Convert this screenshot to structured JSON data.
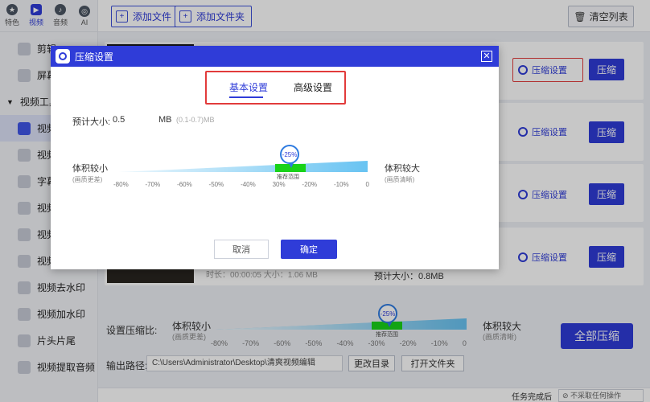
{
  "sidebar": {
    "topnav": [
      {
        "label": "特色",
        "icon": "star-icon"
      },
      {
        "label": "视频",
        "icon": "video-icon",
        "active": true
      },
      {
        "label": "音频",
        "icon": "music-icon"
      },
      {
        "label": "AI",
        "icon": "ai-icon"
      }
    ],
    "items": [
      {
        "label": "剪辑",
        "icon": "scissors-icon"
      },
      {
        "label": "屏幕",
        "icon": "screen-record-icon"
      },
      {
        "label": "视频工具",
        "group": true
      },
      {
        "label": "视频",
        "icon": "video-compress-icon",
        "active": true
      },
      {
        "label": "视频",
        "icon": "video-convert-icon"
      },
      {
        "label": "字幕",
        "icon": "subtitle-icon"
      },
      {
        "label": "视频",
        "icon": "video-split-icon"
      },
      {
        "label": "视频",
        "icon": "video-merge-icon"
      },
      {
        "label": "视频",
        "icon": "video-crop-icon"
      },
      {
        "label": "视频去水印",
        "icon": "watermark-remove-icon"
      },
      {
        "label": "视频加水印",
        "icon": "watermark-add-icon"
      },
      {
        "label": "片头片尾",
        "icon": "intro-outro-icon"
      },
      {
        "label": "视频提取音频",
        "icon": "extract-audio-icon"
      }
    ]
  },
  "toolbar": {
    "add_file": "添加文件",
    "add_folder": "添加文件夹",
    "clear_list": "清空列表"
  },
  "files": [
    {
      "settings_label": "压缩设置",
      "compress_label": "压缩",
      "highlight": true
    },
    {
      "settings_label": "压缩设置",
      "compress_label": "压缩"
    },
    {
      "settings_label": "压缩设置",
      "compress_label": "压缩"
    },
    {
      "settings_label": "压缩设置",
      "compress_label": "压缩",
      "meta": "时长：00:00:05   大小：1.06 MB",
      "estimate": "预计大小：0.8MB"
    }
  ],
  "bottom": {
    "set_ratio_label": "设置压缩比:",
    "small_label": "体积较小",
    "small_sub": "(画质更差)",
    "large_label": "体积较大",
    "large_sub": "(画质清晰)",
    "pin_value": "-25%",
    "recommended": "推荐范围",
    "ticks": [
      "-80%",
      "-70%",
      "-60%",
      "-50%",
      "-40%",
      "-30%",
      "-20%",
      "-10%",
      "0"
    ],
    "compress_all": "全部压缩",
    "output_label": "输出路径:",
    "output_path": "C:\\Users\\Administrator\\Desktop\\清爽视频编辑",
    "change_dir": "更改目录",
    "open_folder": "打开文件夹",
    "task_done_label": "任务完成后",
    "task_done_value": "不采取任何操作"
  },
  "dialog": {
    "title": "压缩设置",
    "tab_basic": "基本设置",
    "tab_advanced": "高级设置",
    "est_label": "预计大小:",
    "est_value": "0.5",
    "est_unit": "MB",
    "est_range": "(0.1-0.7)MB",
    "small_label": "体积较小",
    "small_sub": "(画质更差)",
    "large_label": "体积较大",
    "large_sub": "(画质清晰)",
    "pin_value": "-25%",
    "recommended": "推荐范围",
    "ticks": [
      "-80%",
      "-70%",
      "-60%",
      "-50%",
      "-40%",
      "30%",
      "-20%",
      "-10%",
      "0"
    ],
    "compression_value": -25,
    "cancel": "取消",
    "ok": "确定"
  },
  "colors": {
    "accent": "#2f3cd8",
    "highlight": "#e23b3b",
    "recommended": "#19d219",
    "track": "#68c3f2"
  }
}
